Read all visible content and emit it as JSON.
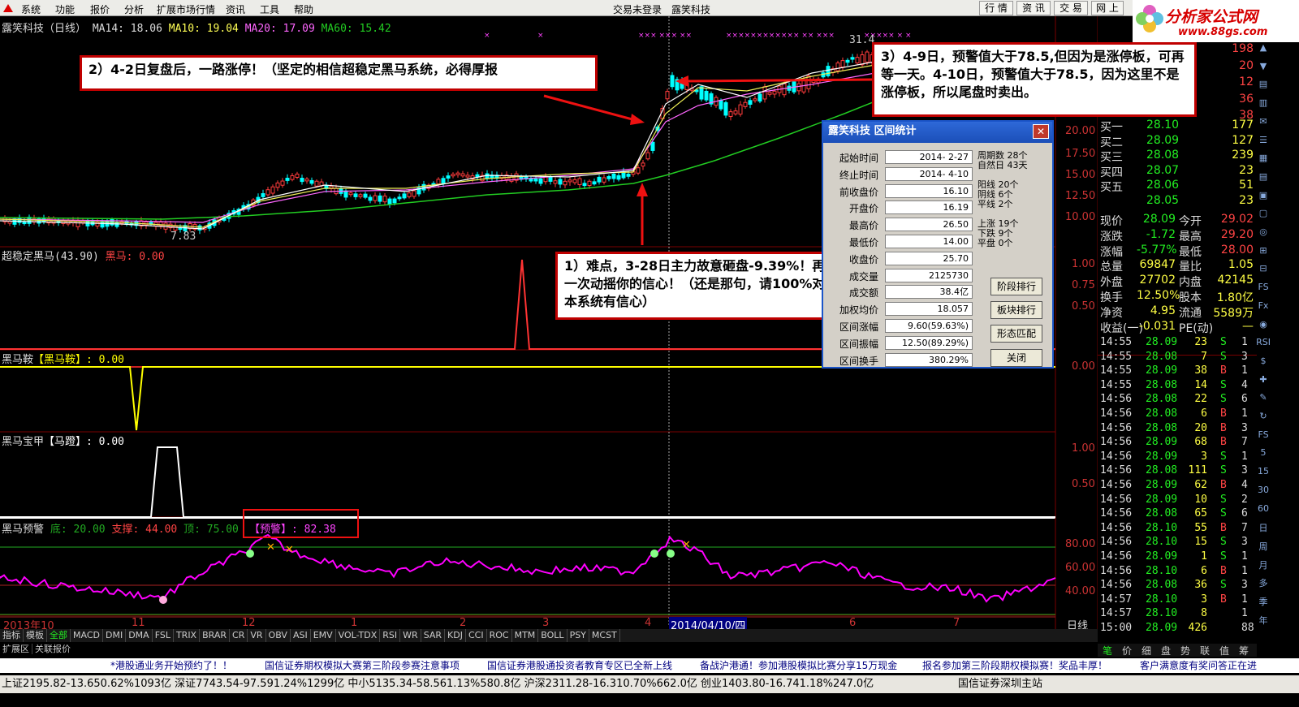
{
  "menu": {
    "items": [
      "系统",
      "功能",
      "报价",
      "分析",
      "扩展市场行情",
      "资讯",
      "工具",
      "帮助"
    ],
    "center": "交易未登录　露笑科技",
    "right_tabs": [
      "行 情",
      "资 讯",
      "交 易",
      "网 上"
    ]
  },
  "brand": {
    "name": "分析家公式网",
    "url": "www.88gs.com"
  },
  "header": {
    "stock": "露笑科技（日线）",
    "ma14": "MA14: 18.06",
    "ma10": "MA10: 19.04",
    "ma20": "MA20: 17.09",
    "ma60": "MA60: 15.42"
  },
  "main_chart": {
    "low_label": "7.83",
    "high_label": "31.4",
    "y_ticks": [
      "20.00",
      "17.50",
      "15.00",
      "12.50",
      "10.00"
    ]
  },
  "panel1": {
    "title": "超稳定黑马(43.90)",
    "item": "黑马: 0.00",
    "y_ticks": [
      "1.00",
      "0.75",
      "0.50"
    ]
  },
  "panel2": {
    "title": "黑马鞍",
    "item": "【黑马鞍】: 0.00",
    "y_ticks": [
      "0.00"
    ]
  },
  "panel3": {
    "title": "黑马宝甲",
    "item": "【马蹬】: 0.00",
    "y_ticks": [
      "1.00",
      "0.50"
    ]
  },
  "panel4": {
    "title": "黑马预警",
    "di": "底: 20.00",
    "zc": "支撑: 44.00",
    "ding": "顶: 75.00",
    "yj": "【预警】: 82.38",
    "y_ticks": [
      "80.00",
      "60.00",
      "40.00"
    ]
  },
  "x_axis": {
    "labels": [
      "2013年10",
      "11",
      "12",
      "1",
      "2",
      "3",
      "4",
      "2014/04/10/四",
      "6",
      "7"
    ],
    "unit": "日线"
  },
  "annotations": {
    "a1": "1）难点，3-28日主力故意砸盘-9.39%！再一次动摇你的信心！（还是那句，请100%对本系统有信心）",
    "a2": "2）4-2日复盘后，一路涨停！（坚定的相信超稳定黑马系统，必得厚报",
    "a3": "3）4-9日，预警值大于78.5,但因为是涨停板，可再等一天。4-10日，预警值大于78.5，因为这里不是涨停板，所以尾盘时卖出。"
  },
  "dialog": {
    "title": "露笑科技 区间统计",
    "close": "✕",
    "rows": [
      [
        "起始时间",
        "2014- 2-27"
      ],
      [
        "终止时间",
        "2014- 4-10"
      ],
      [
        "前收盘价",
        "16.10"
      ],
      [
        "开盘价",
        "16.19"
      ],
      [
        "最高价",
        "26.50"
      ],
      [
        "最低价",
        "14.00"
      ],
      [
        "收盘价",
        "25.70"
      ],
      [
        "成交量",
        "2125730"
      ],
      [
        "成交额",
        "38.4亿"
      ],
      [
        "加权均价",
        "18.057"
      ],
      [
        "区间涨幅",
        "9.60(59.63%)"
      ],
      [
        "区间振幅",
        "12.50(89.29%)"
      ],
      [
        "区间换手",
        "380.29%"
      ]
    ],
    "side": [
      "周期数 28个",
      "自然日 43天",
      "阳线 20个",
      "阴线 6个",
      "平线 2个",
      "上涨 19个",
      "下跌 9个",
      "平盘 0个"
    ],
    "buttons": [
      "阶段排行",
      "板块排行",
      "形态匹配",
      "关闭"
    ]
  },
  "orderbook": {
    "sell_top": [
      "198",
      "20",
      "12",
      "36",
      "38"
    ],
    "buy": [
      [
        "买一",
        "28.10",
        "177"
      ],
      [
        "买二",
        "28.09",
        "127"
      ],
      [
        "买三",
        "28.08",
        "239"
      ],
      [
        "买四",
        "28.07",
        "23"
      ],
      [
        "买五",
        "28.06",
        "51"
      ],
      [
        "",
        "28.05",
        "23"
      ]
    ],
    "stats": [
      [
        "现价",
        "28.09",
        "今开",
        "29.02"
      ],
      [
        "涨跌",
        "-1.72",
        "最高",
        "29.20"
      ],
      [
        "涨幅",
        "-5.77%",
        "最低",
        "28.00"
      ],
      [
        "总量",
        "69847",
        "量比",
        "1.05"
      ],
      [
        "外盘",
        "27702",
        "内盘",
        "42145"
      ],
      [
        "换手",
        "12.50%",
        "股本",
        "1.80亿"
      ],
      [
        "净资",
        "4.95",
        "流通",
        "5589万"
      ],
      [
        "收益(一)",
        "-0.031",
        "PE(动)",
        "—"
      ]
    ]
  },
  "ticks": [
    [
      "14:55",
      "28.09",
      "23",
      "S",
      "1"
    ],
    [
      "14:55",
      "28.08",
      "7",
      "S",
      "3"
    ],
    [
      "14:55",
      "28.09",
      "38",
      "B",
      "1"
    ],
    [
      "14:55",
      "28.08",
      "14",
      "S",
      "4"
    ],
    [
      "14:56",
      "28.08",
      "22",
      "S",
      "6"
    ],
    [
      "14:56",
      "28.08",
      "6",
      "B",
      "1"
    ],
    [
      "14:56",
      "28.08",
      "20",
      "B",
      "3"
    ],
    [
      "14:56",
      "28.09",
      "68",
      "B",
      "7"
    ],
    [
      "14:56",
      "28.09",
      "3",
      "S",
      "1"
    ],
    [
      "14:56",
      "28.08",
      "111",
      "S",
      "3"
    ],
    [
      "14:56",
      "28.09",
      "62",
      "B",
      "4"
    ],
    [
      "14:56",
      "28.09",
      "10",
      "S",
      "2"
    ],
    [
      "14:56",
      "28.08",
      "65",
      "S",
      "6"
    ],
    [
      "14:56",
      "28.10",
      "55",
      "B",
      "7"
    ],
    [
      "14:56",
      "28.10",
      "15",
      "S",
      "3"
    ],
    [
      "14:56",
      "28.09",
      "1",
      "S",
      "1"
    ],
    [
      "14:56",
      "28.10",
      "6",
      "B",
      "1"
    ],
    [
      "14:56",
      "28.08",
      "36",
      "S",
      "3"
    ],
    [
      "14:57",
      "28.10",
      "3",
      "B",
      "1"
    ],
    [
      "14:57",
      "28.10",
      "8",
      "",
      "1"
    ],
    [
      "15:00",
      "28.09",
      "426",
      "",
      "88"
    ]
  ],
  "indicator_tabs": [
    "指标",
    "模板",
    "全部",
    "MACD",
    "DMI",
    "DMA",
    "FSL",
    "TRIX",
    "BRAR",
    "CR",
    "VR",
    "OBV",
    "ASI",
    "EMV",
    "VOL-TDX",
    "RSI",
    "WR",
    "SAR",
    "KDJ",
    "CCI",
    "ROC",
    "MTM",
    "BOLL",
    "PSY",
    "MCST"
  ],
  "bottom_tabs": [
    "扩展区",
    "关联报价"
  ],
  "right_bottom_tabs": [
    "笔",
    "价",
    "细",
    "盘",
    "势",
    "联",
    "值",
    "筹"
  ],
  "news": [
    "*港股通业务开始预约了！！",
    "国信证券期权模拟大赛第三阶段参赛注意事项",
    "国信证券港股通投资者教育专区已全新上线",
    "备战沪港通！参加港股模拟比赛分享15万现金",
    "报名参加第三阶段期权模拟赛！奖品丰厚！",
    "客户满意度有奖问答正在进"
  ],
  "status": "上证2195.82-13.650.62%1093亿 深证7743.54-97.591.24%1299亿 中小5135.34-58.561.13%580.8亿 沪深2311.28-16.310.70%662.0亿 创业1403.80-16.741.18%247.0亿",
  "status_right": "国信证券深圳主站",
  "colors": {
    "up": "#ff3c3c",
    "down": "#00ffff",
    "accent": "#c00000",
    "ma_green": "#22cc22",
    "pink": "#ff00ff",
    "yellow": "#ffff00"
  }
}
